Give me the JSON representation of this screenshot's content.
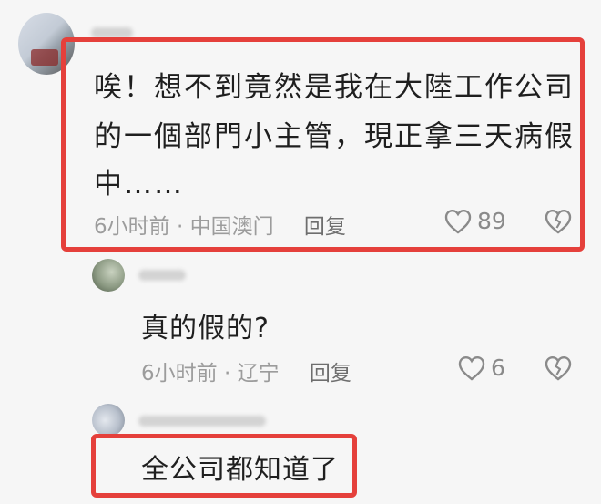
{
  "comments": [
    {
      "lines": [
        "唉！想不到竟然是我在大陸工作公司",
        "的一個部門小主管，現正拿三天病假",
        "中……"
      ],
      "time": "6小时前",
      "location": "中国澳门",
      "reply": "回复",
      "likes": "89"
    },
    {
      "text": "真的假的?",
      "time": "6小时前",
      "location": "辽宁",
      "reply": "回复",
      "likes": "6"
    },
    {
      "text": "全公司都知道了"
    }
  ],
  "separator": "·",
  "colors": {
    "highlight": "#e5403b",
    "meta": "#9c9c9c",
    "text": "#1f1f1f"
  },
  "icons": [
    "heart-icon",
    "broken-heart-icon"
  ]
}
